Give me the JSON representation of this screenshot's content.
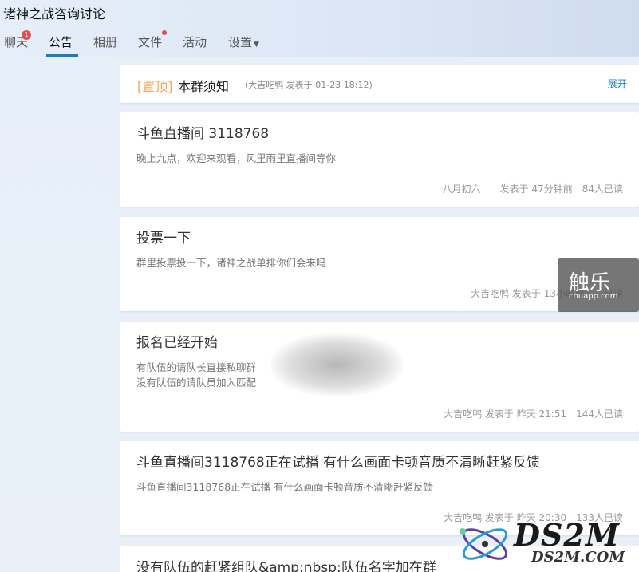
{
  "group": {
    "title": "诸神之战咨询讨论"
  },
  "tabs": [
    {
      "label": "聊天",
      "badge": "1"
    },
    {
      "label": "公告"
    },
    {
      "label": "相册"
    },
    {
      "label": "文件"
    },
    {
      "label": "活动"
    },
    {
      "label": "设置"
    }
  ],
  "pinned": {
    "tag": "[置顶]",
    "title": "本群须知",
    "meta": "(大吉吃鸭 发表于 01-23 18:12)",
    "expand": "展开"
  },
  "announcements": [
    {
      "title": "斗鱼直播间 3118768",
      "body": "晚上九点，欢迎来观看，风里雨里直播间等你",
      "meta": "八月初六　　发表于 47分钟前　84人已读"
    },
    {
      "title": "投票一下",
      "body": "群里投票投一下，诸神之战单排你们会来吗",
      "meta": "大吉吃鸭 发表于 13小时前　　已读"
    },
    {
      "title": "报名已经开始",
      "body_lines": [
        "有队伍的请队长直接私聊群",
        "没有队伍的请队员加入匹配"
      ],
      "meta": "大吉吃鸭 发表于 昨天 21:51　144人已读"
    },
    {
      "title": "斗鱼直播间3118768正在试播 有什么画面卡顿音质不清晰赶紧反馈",
      "body": "斗鱼直播间3118768正在试播 有什么画面卡顿音质不清晰赶紧反馈",
      "meta": "大吉吃鸭 发表于 昨天 20:30　133人已读"
    },
    {
      "title": "没有队伍的赶紧组队&amp;nbsp;队伍名字加在群"
    }
  ],
  "watermarks": {
    "chuapp_main": "触乐",
    "chuapp_sub": "chuapp.com",
    "ds2m_main": "DS2M",
    "ds2m_sub": "DS2M.COM"
  }
}
